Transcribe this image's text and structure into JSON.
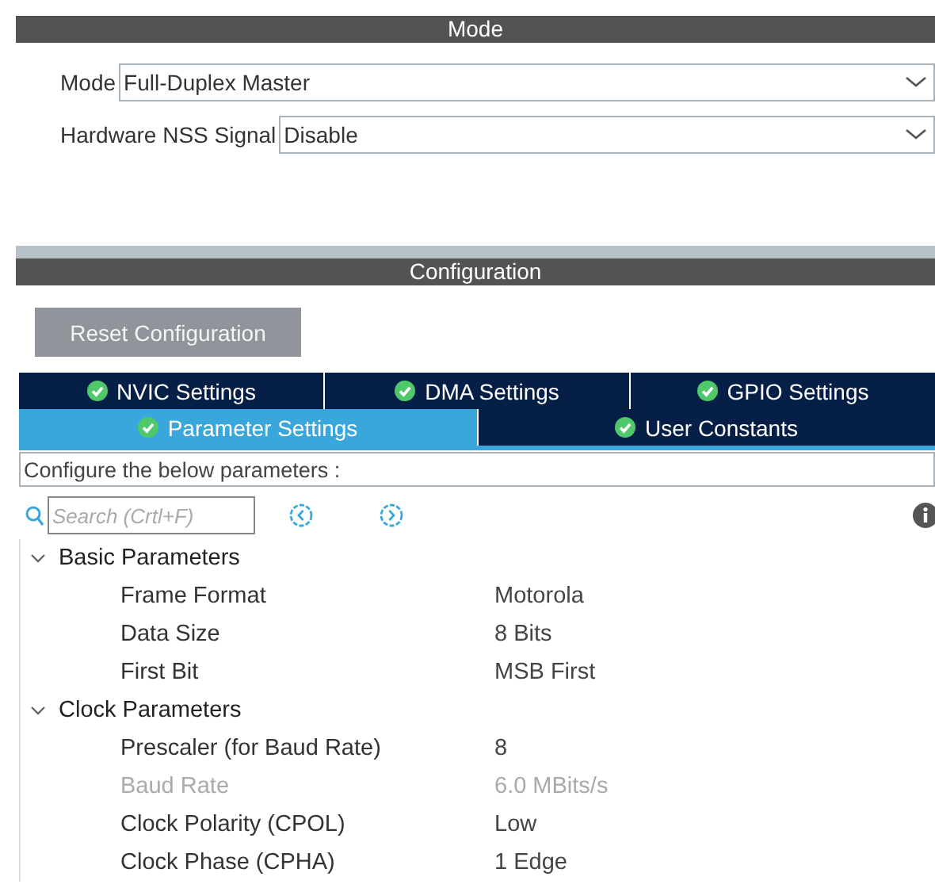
{
  "mode_section": {
    "title": "Mode",
    "fields": [
      {
        "label": "Mode",
        "value": "Full-Duplex Master"
      },
      {
        "label": "Hardware NSS Signal",
        "value": "Disable"
      }
    ]
  },
  "configuration": {
    "title": "Configuration",
    "reset_button": "Reset Configuration",
    "tab_rows": [
      [
        {
          "label": "NVIC Settings",
          "selected": false
        },
        {
          "label": "DMA Settings",
          "selected": false
        },
        {
          "label": "GPIO Settings",
          "selected": false
        }
      ],
      [
        {
          "label": "Parameter Settings",
          "selected": true
        },
        {
          "label": "User Constants",
          "selected": false
        }
      ]
    ],
    "info": "Configure the below parameters :",
    "search": {
      "placeholder": "Search (Crtl+F)"
    },
    "groups": [
      {
        "name": "Basic Parameters",
        "expanded": true,
        "params": [
          {
            "name": "Frame Format",
            "value": "Motorola",
            "disabled": false
          },
          {
            "name": "Data Size",
            "value": "8 Bits",
            "disabled": false
          },
          {
            "name": "First Bit",
            "value": "MSB First",
            "disabled": false
          }
        ]
      },
      {
        "name": "Clock Parameters",
        "expanded": true,
        "params": [
          {
            "name": "Prescaler (for Baud Rate)",
            "value": "8",
            "disabled": false
          },
          {
            "name": "Baud Rate",
            "value": "6.0 MBits/s",
            "disabled": true
          },
          {
            "name": "Clock Polarity (CPOL)",
            "value": "Low",
            "disabled": false
          },
          {
            "name": "Clock Phase (CPHA)",
            "value": "1 Edge",
            "disabled": false
          }
        ]
      }
    ]
  }
}
